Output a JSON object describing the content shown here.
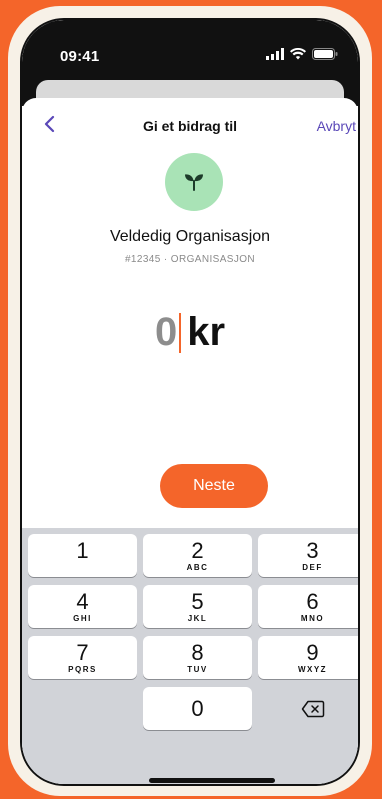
{
  "status_bar": {
    "time": "09:41"
  },
  "nav": {
    "title": "Gi et bidrag til",
    "cancel_label": "Avbryt"
  },
  "organization": {
    "name": "Veldedig Organisasjon",
    "meta": "#12345 · ORGANISASJON",
    "icon": "seedling-icon",
    "avatar_color": "#a9e3b6"
  },
  "amount": {
    "value": "0",
    "currency": "kr"
  },
  "next_button": {
    "label": "Neste"
  },
  "keypad": {
    "keys": [
      {
        "digit": "1",
        "letters": ""
      },
      {
        "digit": "2",
        "letters": "ABC"
      },
      {
        "digit": "3",
        "letters": "DEF"
      },
      {
        "digit": "4",
        "letters": "GHI"
      },
      {
        "digit": "5",
        "letters": "JKL"
      },
      {
        "digit": "6",
        "letters": "MNO"
      },
      {
        "digit": "7",
        "letters": "PQRS"
      },
      {
        "digit": "8",
        "letters": "TUV"
      },
      {
        "digit": "9",
        "letters": "WXYZ"
      },
      {
        "digit": "0",
        "letters": ""
      }
    ]
  },
  "colors": {
    "accent": "#f4652a",
    "link": "#5a48b8"
  }
}
